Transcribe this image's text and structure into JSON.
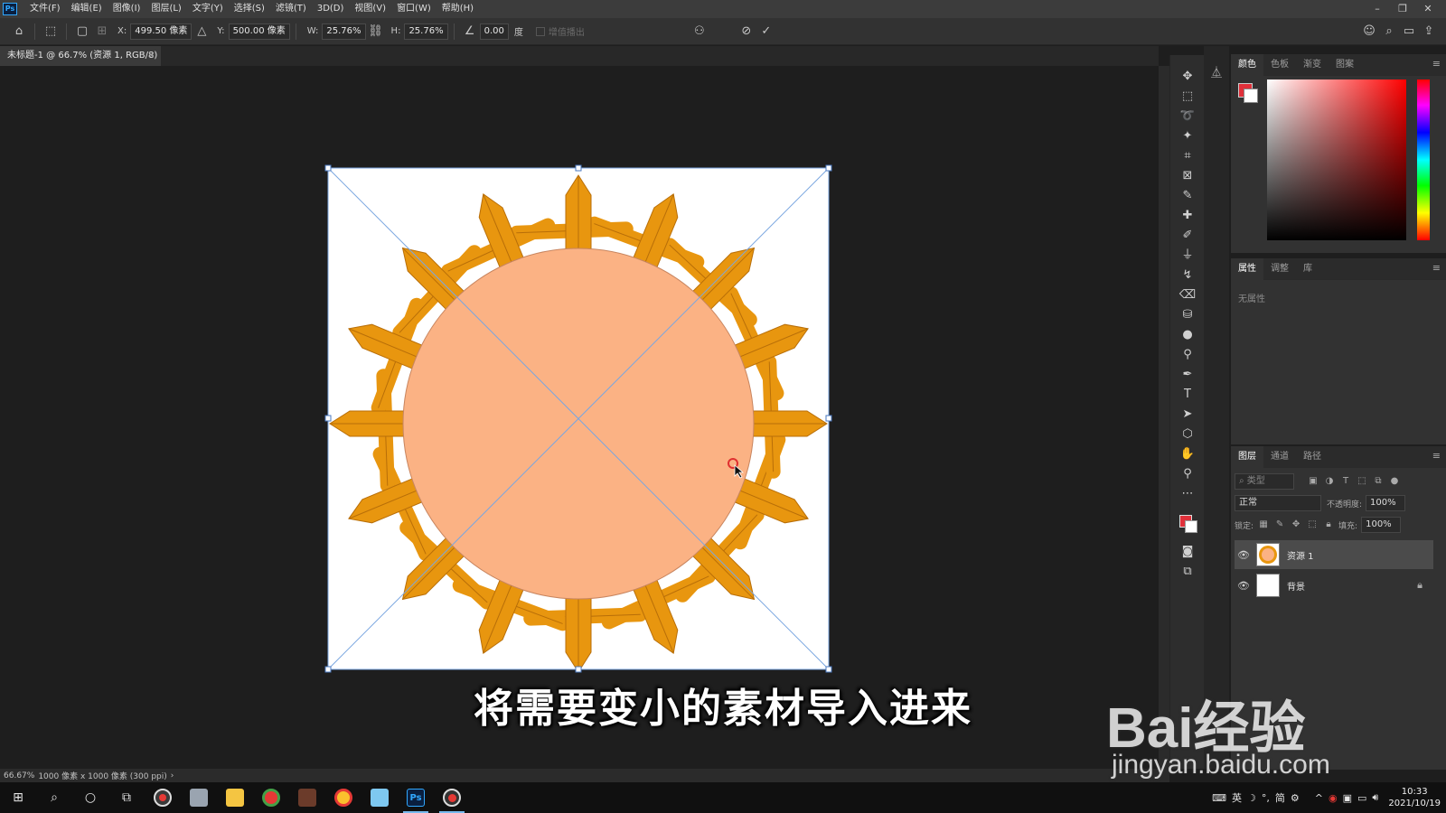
{
  "app": {
    "logo": "Ps",
    "title": "未标题-1 @ 66.7% (资源 1, RGB/8)"
  },
  "menu": [
    "文件(F)",
    "编辑(E)",
    "图像(I)",
    "图层(L)",
    "文字(Y)",
    "选择(S)",
    "滤镜(T)",
    "3D(D)",
    "视图(V)",
    "窗口(W)",
    "帮助(H)"
  ],
  "options": {
    "x_label": "X:",
    "x_value": "499.50 像素",
    "y_label": "Y:",
    "y_value": "500.00 像素",
    "w_label": "W:",
    "w_value": "25.76%",
    "h_label": "H:",
    "h_value": "25.76%",
    "angle_value": "0.00",
    "angle_unit": "度",
    "interp_label": "增值播出"
  },
  "doc_tab": {
    "title": "未标题-1 @ 66.7% (资源 1, RGB/8)",
    "close": "×"
  },
  "colors": {
    "foreground": "#e0303a",
    "background": "#ffffff",
    "sun_body": "#fbb284",
    "sun_ring": "#e8960f",
    "accent": "#31a8ff"
  },
  "color_panel": {
    "tabs": [
      "颜色",
      "色板",
      "渐变",
      "图案"
    ],
    "active": 0
  },
  "props_panel": {
    "tabs": [
      "属性",
      "调整",
      "库"
    ],
    "active": 0,
    "empty": "无属性"
  },
  "layers_panel": {
    "tabs": [
      "图层",
      "通道",
      "路径"
    ],
    "active": 0,
    "filter_placeholder": "类型",
    "blend_mode": "正常",
    "opacity_label": "不透明度:",
    "opacity_value": "100%",
    "lock_label": "锁定:",
    "fill_label": "填充:",
    "fill_value": "100%",
    "layers": [
      {
        "name": "资源 1",
        "visible": true,
        "selected": true,
        "locked": false
      },
      {
        "name": "背景",
        "visible": true,
        "selected": false,
        "locked": true
      }
    ]
  },
  "status": {
    "zoom": "66.67%",
    "doc_size": "1000 像素 x 1000 像素 (300 ppi)"
  },
  "subtitle": "将需要变小的素材导入进来",
  "watermark": {
    "brand": "Bai经验",
    "url": "jingyan.baidu.com"
  },
  "taskbar": {
    "tray": [
      "英",
      "简"
    ],
    "time": "10:33",
    "date": "2021/10/19"
  }
}
